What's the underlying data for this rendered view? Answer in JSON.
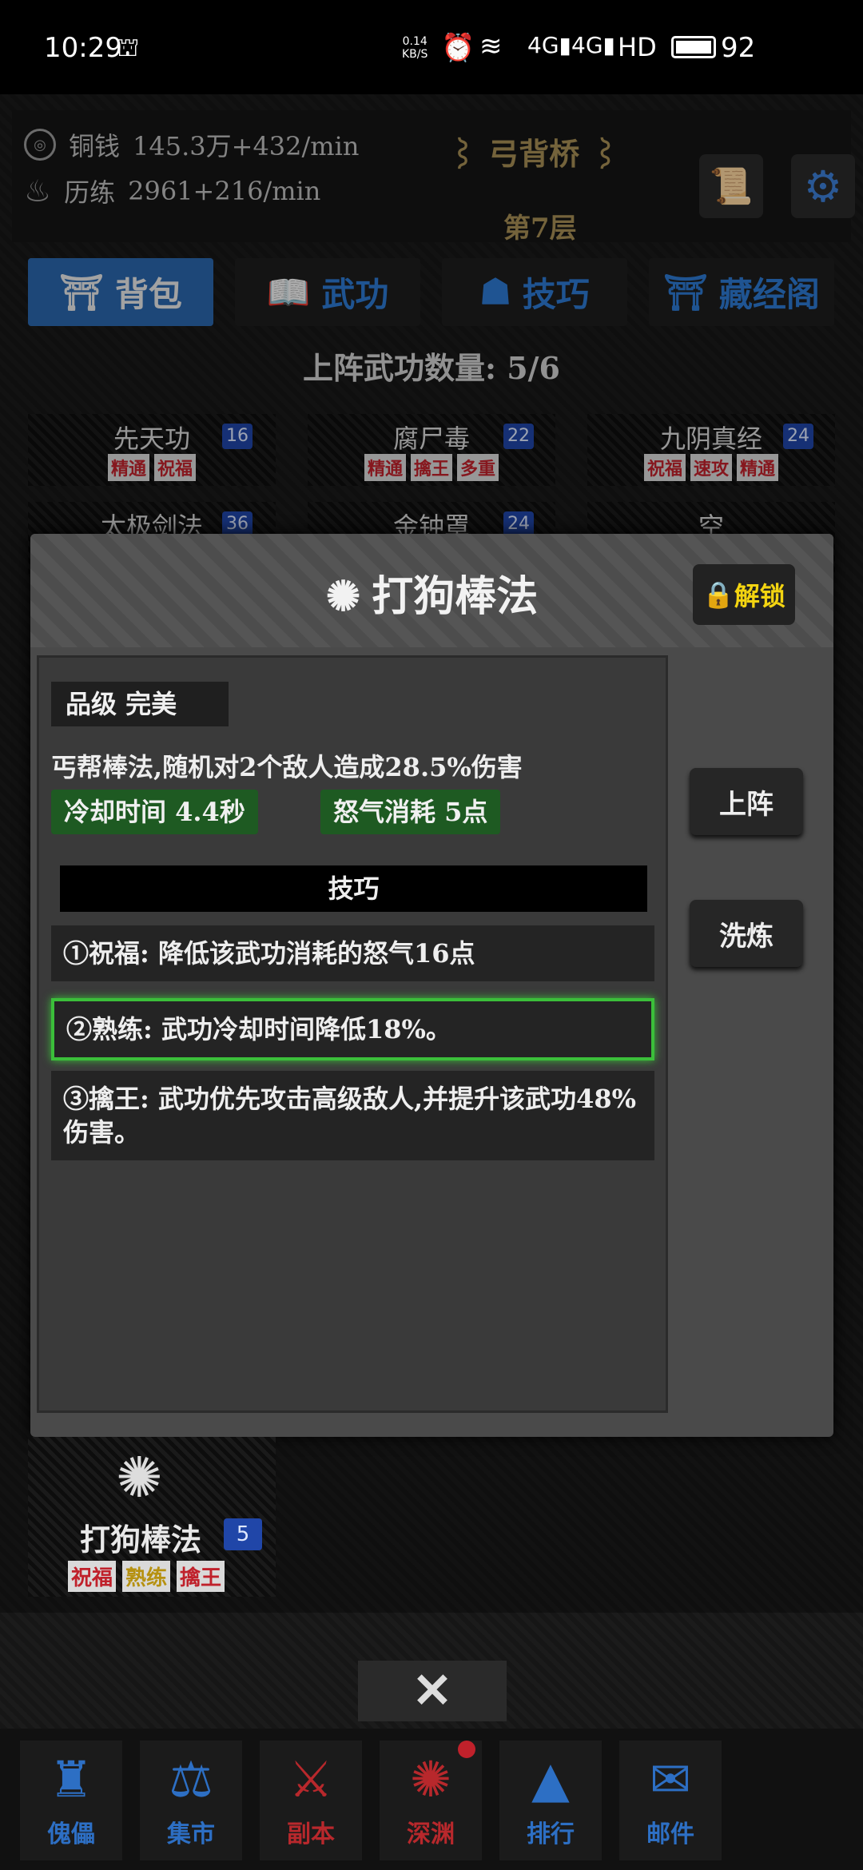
{
  "status_bar": {
    "time": "10:29",
    "net_speed": "0.14",
    "net_unit": "KB/S",
    "signal1": "4G",
    "signal2": "4G",
    "hd": "HD",
    "battery": "92"
  },
  "header": {
    "copper_label": "铜钱",
    "copper_value": "145.3万+432/min",
    "exp_label": "历练",
    "exp_value": "2961+216/min",
    "location": "弓背桥",
    "floor": "第7层"
  },
  "tabs": [
    {
      "label": "背包",
      "icon": "backpack-icon"
    },
    {
      "label": "武功",
      "icon": "book-icon"
    },
    {
      "label": "技巧",
      "icon": "meditate-icon"
    },
    {
      "label": "藏经阁",
      "icon": "pagoda-icon"
    }
  ],
  "active_count": "上阵武功数量: 5/6",
  "cards": [
    {
      "name": "先天功",
      "level": "16",
      "tags": [
        "精通",
        "祝福"
      ]
    },
    {
      "name": "腐尸毒",
      "level": "22",
      "tags": [
        "精通",
        "擒王",
        "多重"
      ]
    },
    {
      "name": "九阴真经",
      "level": "24",
      "tags": [
        "祝福",
        "速攻",
        "精通"
      ]
    },
    {
      "name": "太极剑法",
      "level": "36"
    },
    {
      "name": "金钟罩",
      "level": "24"
    },
    {
      "name": "空"
    }
  ],
  "modal": {
    "title": "打狗棒法",
    "unlock_label": "解锁",
    "grade": "品级   完美",
    "description": "丐帮棒法,随机对2个敌人造成28.5%伤害",
    "cooldown": "冷却时间  4.4秒",
    "rage": "怒气消耗  5点",
    "skills_title": "技巧",
    "skills": [
      "①祝福: 降低该武功消耗的怒气16点",
      "②熟练: 武功冷却时间降低18%。",
      "③擒王: 武功优先攻击高级敌人,并提升该武功48%伤害。"
    ],
    "equip_label": "上阵",
    "refine_label": "洗炼"
  },
  "bottom_card": {
    "name": "打狗棒法",
    "level": "5",
    "tags": [
      "祝福",
      "熟练",
      "擒王"
    ]
  },
  "close_label": "✕",
  "nav": [
    {
      "label": "傀儡"
    },
    {
      "label": "集市"
    },
    {
      "label": "副本"
    },
    {
      "label": "深渊"
    },
    {
      "label": "排行"
    },
    {
      "label": "邮件"
    }
  ],
  "colors": {
    "accent_blue": "#2d79d1",
    "gold": "#a68f55",
    "green_stat": "#1e5a22",
    "highlight_green": "#3bbf3a",
    "unlock_yellow": "#f3d411",
    "tag_red": "#c0212b"
  }
}
